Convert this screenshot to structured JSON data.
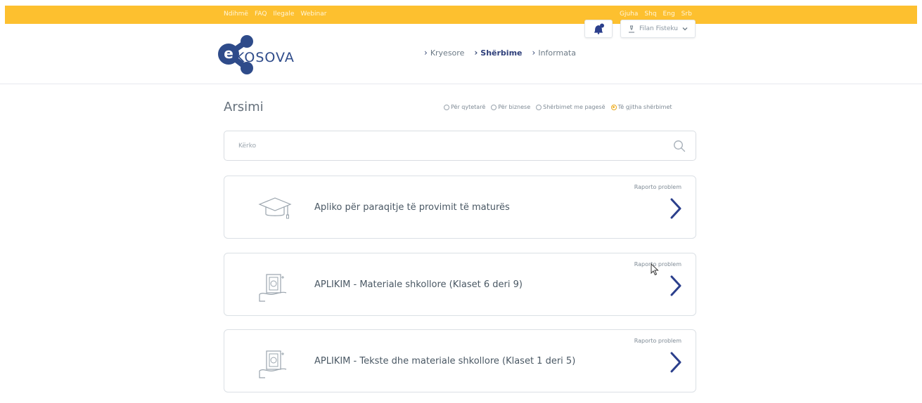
{
  "topbar": {
    "left_links": [
      "Ndihmë",
      "FAQ",
      "Ilegale",
      "Webinar"
    ],
    "right_links": [
      "Gjuha",
      "Shq",
      "Eng",
      "Srb"
    ]
  },
  "header": {
    "logo_text": "KOSOVA",
    "nav": [
      {
        "label": "Kryesore",
        "active": false
      },
      {
        "label": "Shërbime",
        "active": true
      },
      {
        "label": "Informata",
        "active": false
      }
    ],
    "user_name": "Filan Fisteku"
  },
  "page": {
    "title": "Arsimi",
    "filters": [
      {
        "label": "Për qytetarë",
        "selected": false
      },
      {
        "label": "Për biznese",
        "selected": false
      },
      {
        "label": "Shërbimet me pagesë",
        "selected": false
      },
      {
        "label": "Të gjitha shërbimet",
        "selected": true
      }
    ],
    "search_placeholder": "Kërko"
  },
  "services": [
    {
      "title": "Apliko për paraqitje të provimit të maturës",
      "report_label": "Raporto problem",
      "icon": "graduation-cap-icon"
    },
    {
      "title": "APLIKIM - Materiale shkollore (Klaset 6 deri 9)",
      "report_label": "Raporto problem",
      "icon": "school-materials-icon"
    },
    {
      "title": "APLIKIM - Tekste dhe materiale shkollore (Klaset 1 deri 5)",
      "report_label": "Raporto problem",
      "icon": "school-materials-icon"
    }
  ],
  "colors": {
    "topbar": "#fdc02f",
    "brand_blue": "#2e4b8a",
    "arrow_blue": "#2b3f8c"
  }
}
